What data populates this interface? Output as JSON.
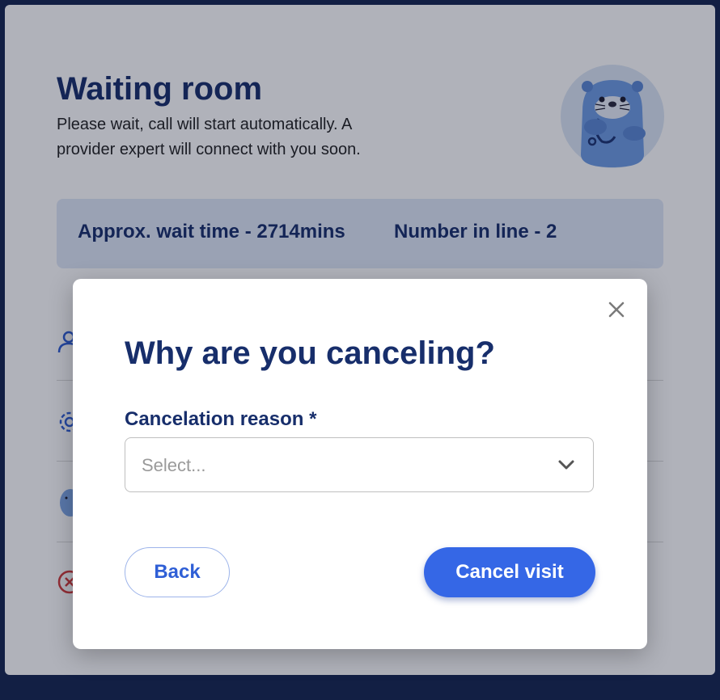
{
  "page": {
    "title": "Waiting room",
    "subtitle": "Please wait, call will start automatically. A provider expert will connect with you soon.",
    "mascot_icon": "otter-doctor-illustration",
    "wait_banner": {
      "wait_time": "Approx. wait time - 2714mins",
      "number_in_line": "Number in line - 2"
    },
    "list_icons": [
      "person-icon",
      "gear-icon",
      "otter-avatar-icon",
      "cancel-circle-icon"
    ]
  },
  "modal": {
    "title": "Why are you canceling?",
    "field_label": "Cancelation reason *",
    "select_placeholder": "Select...",
    "back_label": "Back",
    "cancel_label": "Cancel visit",
    "close_icon": "close-icon"
  },
  "colors": {
    "primary_text": "#172e6b",
    "accent": "#3567e6",
    "banner_bg": "#dfe8f7",
    "page_bg": "#14254f",
    "danger": "#d23b3b"
  }
}
